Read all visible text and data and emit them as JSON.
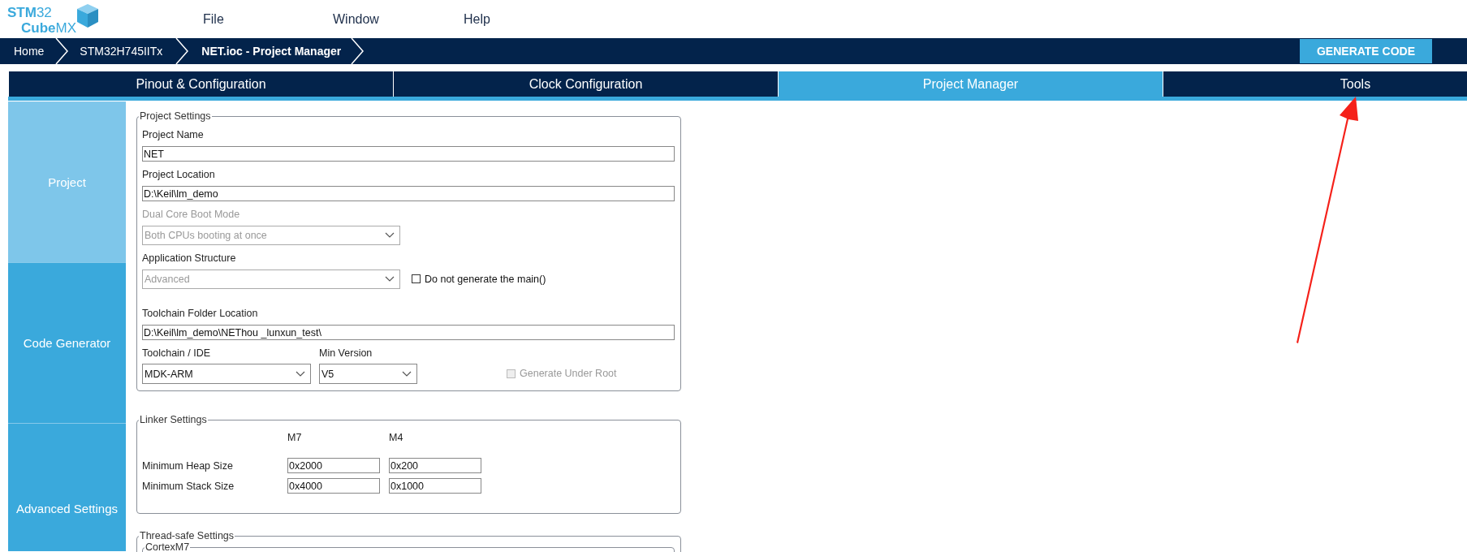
{
  "logo": {
    "top": "**STM**32",
    "bottom": "**Cube**MX"
  },
  "menu": [
    "File",
    "Window",
    "Help"
  ],
  "breadcrumbs": [
    {
      "label": "Home",
      "selected": false
    },
    {
      "label": "STM32H745IITx",
      "selected": false
    },
    {
      "label": "NET.ioc - Project Manager",
      "selected": true
    }
  ],
  "generate_button": "GENERATE CODE",
  "tabs": [
    {
      "label": "Pinout & Configuration",
      "selected": false
    },
    {
      "label": "Clock Configuration",
      "selected": false
    },
    {
      "label": "Project Manager",
      "selected": true
    },
    {
      "label": "Tools",
      "selected": false
    }
  ],
  "sidebar": [
    {
      "label": "Project",
      "selected": true
    },
    {
      "label": "Code Generator",
      "selected": false
    },
    {
      "label": "Advanced Settings",
      "selected": false
    }
  ],
  "project_settings": {
    "title": "Project Settings",
    "rows": [
      {
        "kind": "text",
        "label": "Project Name",
        "value": "NET"
      },
      {
        "kind": "text",
        "label": "Project Location",
        "value": "D:\\Keil\\lm_demo"
      },
      {
        "kind": "select",
        "label": "Dual Core Boot Mode",
        "value": "Both CPUs booting at once",
        "disabled": true,
        "label_disabled": true
      },
      {
        "kind": "select",
        "label": "Application Structure",
        "value": "Advanced",
        "disabled": true,
        "label_disabled": false,
        "checkbox": {
          "label": "Do not generate the main()",
          "checked": false,
          "disabled": false
        }
      },
      {
        "kind": "text",
        "label": "Toolchain Folder Location",
        "value": "D:\\Keil\\lm_demo\\NEThou _lunxun_test\\"
      },
      {
        "kind": "pair",
        "selects": [
          {
            "label": "Toolchain / IDE",
            "value": "MDK-ARM"
          },
          {
            "label": "Min Version",
            "value": "V5"
          }
        ],
        "checkbox": {
          "label": "Generate Under Root",
          "checked": false,
          "disabled": true
        }
      }
    ]
  },
  "linker_settings": {
    "title": "Linker Settings",
    "columns": [
      "M7",
      "M4"
    ],
    "rows": [
      {
        "label": "Minimum Heap Size",
        "values": [
          "0x2000",
          "0x200"
        ]
      },
      {
        "label": "Minimum Stack Size",
        "values": [
          "0x4000",
          "0x1000"
        ]
      }
    ]
  },
  "thread_safe_settings": {
    "title": "Thread-safe Settings",
    "group": "CortexM7"
  }
}
